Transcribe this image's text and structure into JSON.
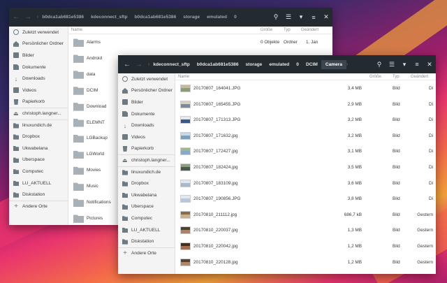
{
  "back_window": {
    "breadcrumbs": [
      "b0dca1ab681e5386",
      "kdeconnect_sftp",
      "b0dca1ab681e5386",
      "storage",
      "emulated",
      "0"
    ],
    "columns": {
      "name": "Name",
      "size": "Größe",
      "type": "Typ",
      "modified": "Geändert"
    },
    "sidebar": [
      "Zuletzt verwendet",
      "Persönlicher Ordner",
      "Bilder",
      "Dokumente",
      "Downloads",
      "Videos",
      "Papierkorb",
      "christoph.langner...",
      "linuxundich.de",
      "Dropbox",
      "Ukwabelana",
      "Uberspace",
      "Computec",
      "LU_AKTUELL",
      "Diskstation",
      "Andere Orte"
    ],
    "files": [
      {
        "name": "Alarms",
        "size": "0 Objekte",
        "type": "Ordner",
        "modified": "1. Jan"
      },
      {
        "name": "Android",
        "size": "",
        "type": "",
        "modified": ""
      },
      {
        "name": "data",
        "size": "",
        "type": "",
        "modified": ""
      },
      {
        "name": "DCIM",
        "size": "",
        "type": "",
        "modified": ""
      },
      {
        "name": "Download",
        "size": "",
        "type": "",
        "modified": ""
      },
      {
        "name": "ELEMNT",
        "size": "",
        "type": "",
        "modified": ""
      },
      {
        "name": "LGBackup",
        "size": "",
        "type": "",
        "modified": ""
      },
      {
        "name": "LGWorld",
        "size": "",
        "type": "",
        "modified": ""
      },
      {
        "name": "Movies",
        "size": "",
        "type": "",
        "modified": ""
      },
      {
        "name": "Music",
        "size": "",
        "type": "",
        "modified": ""
      },
      {
        "name": "Notifications",
        "size": "",
        "type": "",
        "modified": ""
      },
      {
        "name": "Pictures",
        "size": "",
        "type": "",
        "modified": ""
      }
    ]
  },
  "front_window": {
    "breadcrumbs": [
      "kdeconnect_sftp",
      "b0dca1ab681e5386",
      "storage",
      "emulated",
      "0",
      "DCIM",
      "Camera"
    ],
    "columns": {
      "name": "Name",
      "size": "Größe",
      "type": "Typ",
      "modified": "Geändert"
    },
    "sidebar": [
      "Zuletzt verwendet",
      "Persönlicher Ordner",
      "Bilder",
      "Dokumente",
      "Downloads",
      "Videos",
      "Papierkorb",
      "christoph.langner...",
      "linuxundich.de",
      "Dropbox",
      "Ukwabelana",
      "Uberspace",
      "Computec",
      "LU_AKTUELL",
      "Diskstation",
      "Andere Orte"
    ],
    "files": [
      {
        "name": "20170807_164041.JPG",
        "size": "3,4 MB",
        "type": "Bild",
        "modified": "Di"
      },
      {
        "name": "20170807_165455.JPG",
        "size": "2,9 MB",
        "type": "Bild",
        "modified": "Di"
      },
      {
        "name": "20170807_171313.JPG",
        "size": "3,2 MB",
        "type": "Bild",
        "modified": "Di"
      },
      {
        "name": "20170807_171632.jpg",
        "size": "3,2 MB",
        "type": "Bild",
        "modified": "Di"
      },
      {
        "name": "20170807_172427.jpg",
        "size": "3,1 MB",
        "type": "Bild",
        "modified": "Di"
      },
      {
        "name": "20170807_182424.jpg",
        "size": "3,5 MB",
        "type": "Bild",
        "modified": "Di"
      },
      {
        "name": "20170807_183109.jpg",
        "size": "3,6 MB",
        "type": "Bild",
        "modified": "Di"
      },
      {
        "name": "20170807_190856.JPG",
        "size": "3,8 MB",
        "type": "Bild",
        "modified": "Di"
      },
      {
        "name": "20170810_211112.jpg",
        "size": "686,7 kB",
        "type": "Bild",
        "modified": "Gestern"
      },
      {
        "name": "20170810_220037.jpg",
        "size": "1,3 MB",
        "type": "Bild",
        "modified": "Gestern"
      },
      {
        "name": "20170810_220042.jpg",
        "size": "1,2 MB",
        "type": "Bild",
        "modified": "Gestern"
      },
      {
        "name": "20170810_220128.jpg",
        "size": "1,2 MB",
        "type": "Bild",
        "modified": "Gestern"
      }
    ]
  },
  "sidebar_icons": [
    "clock-icon",
    "home-icon",
    "image-icon",
    "document-icon",
    "download-icon",
    "video-icon",
    "trash-icon",
    "network-drive-icon",
    "folder-icon",
    "folder-icon",
    "folder-icon",
    "folder-icon",
    "folder-icon",
    "folder-icon",
    "folder-icon",
    "plus-icon"
  ],
  "colors": {
    "headerbar": "#232a30",
    "sidebar": "#f4f4f4",
    "active_crumb": "#3b454d"
  }
}
